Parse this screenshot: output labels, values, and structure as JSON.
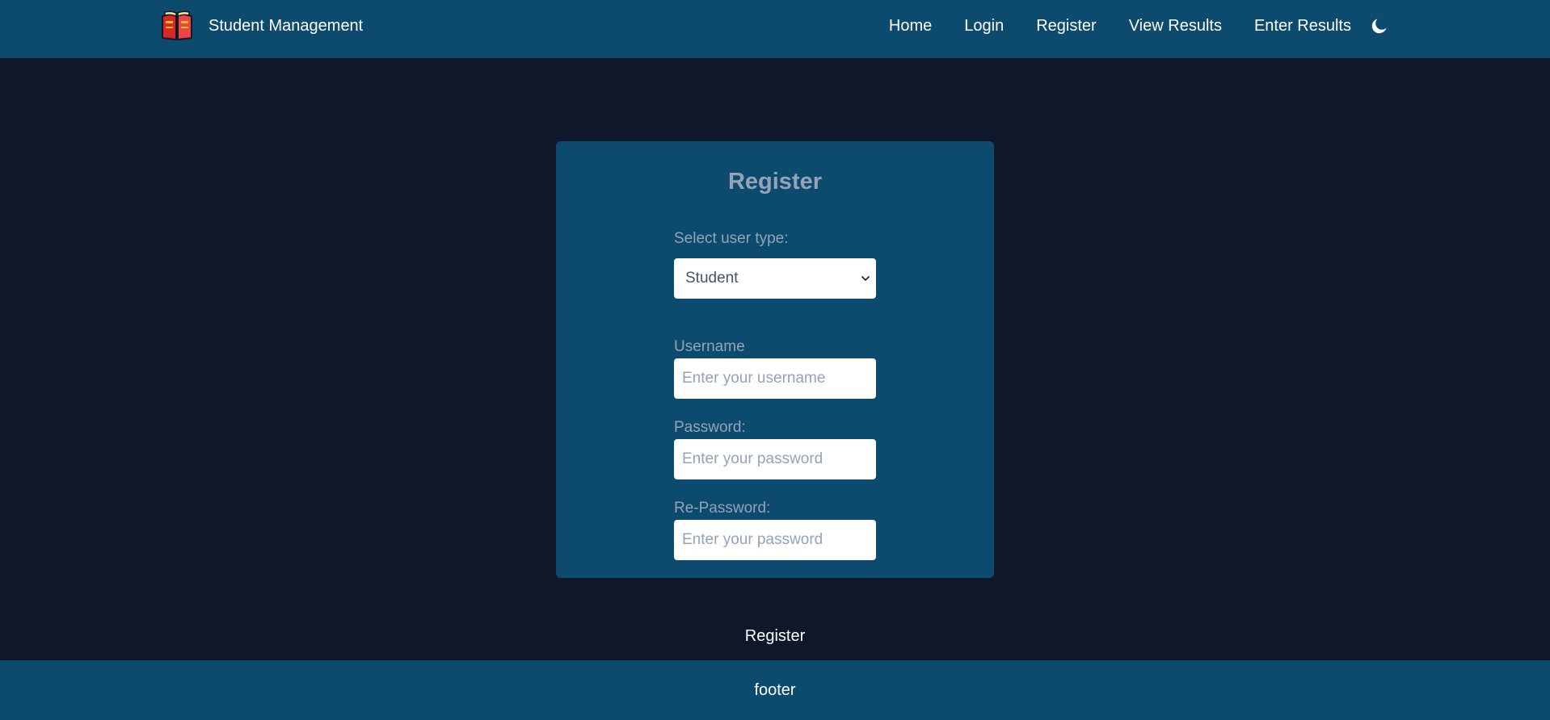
{
  "navbar": {
    "logo_icon": "open-book-icon",
    "brand": "Student Management",
    "links": {
      "home": "Home",
      "login": "Login",
      "register": "Register",
      "view_results": "View Results",
      "enter_results": "Enter Results"
    },
    "theme_icon": "moon-icon"
  },
  "form": {
    "title": "Register",
    "user_type": {
      "label": "Select user type:",
      "selected": "Student"
    },
    "username": {
      "label": "Username",
      "placeholder": "Enter your username",
      "value": ""
    },
    "password": {
      "label": "Password:",
      "placeholder": "Enter your password",
      "value": ""
    },
    "repassword": {
      "label": "Re-Password:",
      "placeholder": "Enter your password",
      "value": ""
    },
    "submit_label": "Register"
  },
  "footer": {
    "text": "footer"
  },
  "colors": {
    "page_background": "#0f172a",
    "nav_background": "#0c4a6e",
    "card_background": "#0c4a6e",
    "muted_text": "#94a3b8",
    "text": "#ffffff"
  }
}
